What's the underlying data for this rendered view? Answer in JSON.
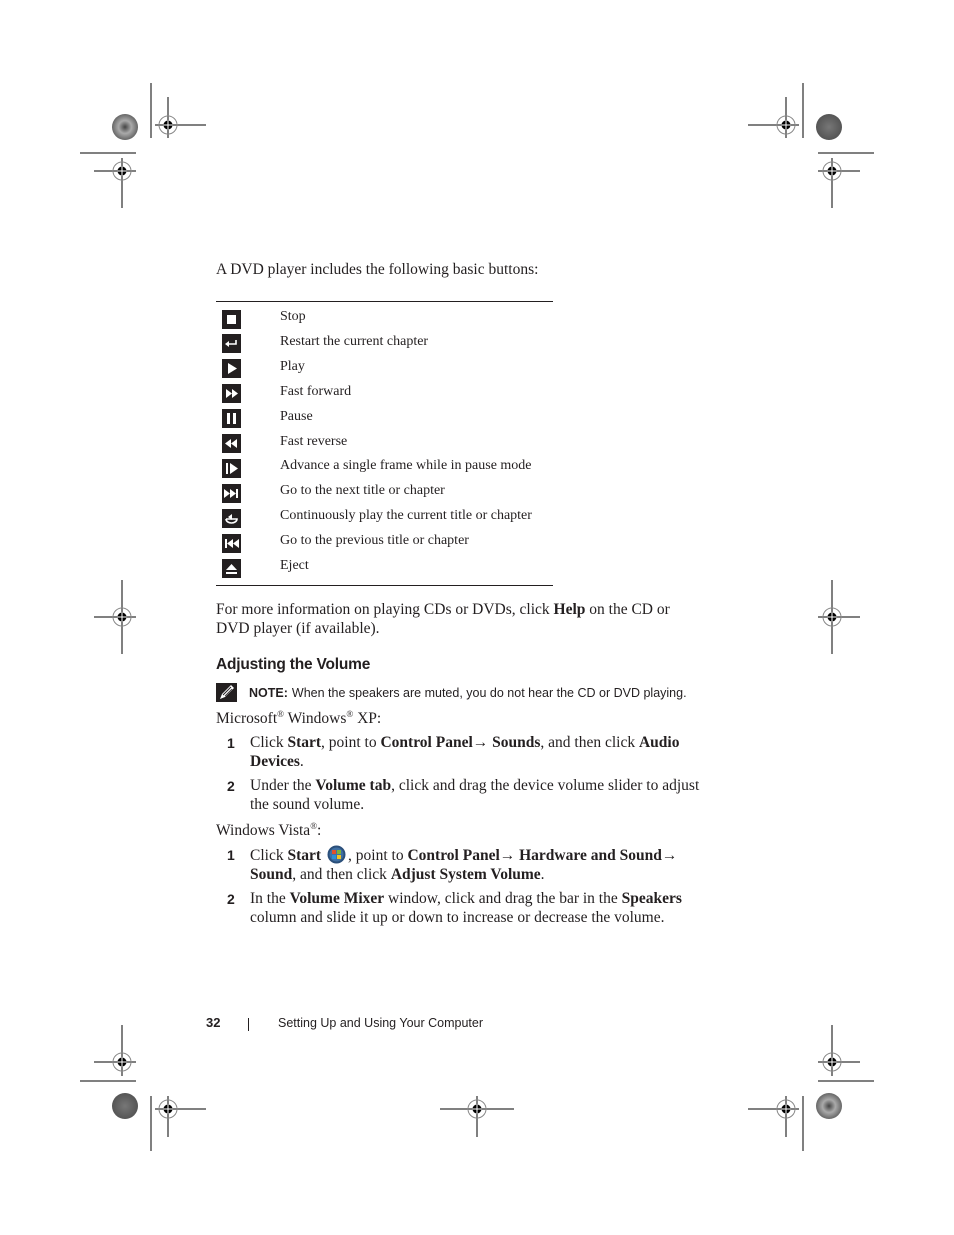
{
  "intro": "A DVD player includes the following basic buttons:",
  "buttons_table": [
    {
      "icon": "stop-icon",
      "label": "Stop"
    },
    {
      "icon": "restart-chapter-icon",
      "label": "Restart the current chapter"
    },
    {
      "icon": "play-icon",
      "label": "Play"
    },
    {
      "icon": "fast-forward-icon",
      "label": "Fast forward"
    },
    {
      "icon": "pause-icon",
      "label": "Pause"
    },
    {
      "icon": "fast-reverse-icon",
      "label": "Fast reverse"
    },
    {
      "icon": "frame-advance-icon",
      "label": "Advance a single frame while in pause mode"
    },
    {
      "icon": "next-title-icon",
      "label": "Go to the next title or chapter"
    },
    {
      "icon": "repeat-icon",
      "label": "Continuously play the current title or chapter"
    },
    {
      "icon": "previous-title-icon",
      "label": "Go to the previous title or chapter"
    },
    {
      "icon": "eject-icon",
      "label": "Eject"
    }
  ],
  "more_info": {
    "before": "For more information on playing CDs or DVDs, click ",
    "bold": "Help",
    "after": " on the CD or DVD player (if available)."
  },
  "section_heading": "Adjusting the Volume",
  "note": {
    "label": "NOTE:",
    "text": " When the speakers are muted, you do not hear the CD or DVD playing."
  },
  "xp": {
    "heading_parts": [
      "Microsoft",
      "®",
      " Windows",
      "®",
      " XP:"
    ],
    "steps": [
      {
        "num": "1",
        "segments": [
          {
            "t": "Click ",
            "b": false
          },
          {
            "t": "Start",
            "b": true
          },
          {
            "t": ", point to ",
            "b": false
          },
          {
            "t": "Control Panel→ Sounds",
            "b": true
          },
          {
            "t": ", and then click ",
            "b": false
          },
          {
            "t": "Audio Devices",
            "b": true
          },
          {
            "t": ".",
            "b": false
          }
        ]
      },
      {
        "num": "2",
        "segments": [
          {
            "t": "Under the ",
            "b": false
          },
          {
            "t": "Volume tab",
            "b": true
          },
          {
            "t": ", click and drag the device volume slider to adjust the sound volume.",
            "b": false
          }
        ]
      }
    ]
  },
  "vista": {
    "heading_parts": [
      "Windows Vista",
      "®",
      ":"
    ],
    "steps": [
      {
        "num": "1",
        "segments": [
          {
            "t": "Click ",
            "b": false
          },
          {
            "t": "Start",
            "b": true
          },
          {
            "t": "[icon]",
            "b": false
          },
          {
            "t": ", point to ",
            "b": false
          },
          {
            "t": "Control Panel→ Hardware and Sound→ Sound",
            "b": true
          },
          {
            "t": ", and then click ",
            "b": false
          },
          {
            "t": "Adjust System Volume",
            "b": true
          },
          {
            "t": ".",
            "b": false
          }
        ]
      },
      {
        "num": "2",
        "segments": [
          {
            "t": "In the ",
            "b": false
          },
          {
            "t": "Volume Mixer",
            "b": true
          },
          {
            "t": " window, click and drag the bar in the ",
            "b": false
          },
          {
            "t": "Speakers",
            "b": true
          },
          {
            "t": " column and slide it up or down to increase or decrease the volume.",
            "b": false
          }
        ]
      }
    ]
  },
  "footer": {
    "page_number": "32",
    "chapter_title": "Setting Up and Using Your Computer"
  }
}
